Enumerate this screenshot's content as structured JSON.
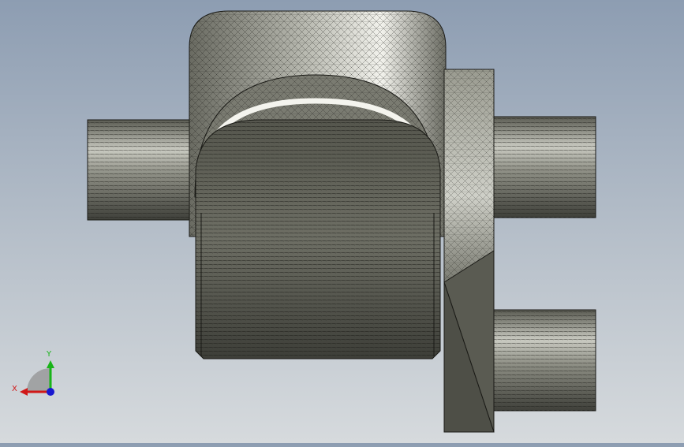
{
  "viewport": {
    "background_top": "#8d9db2",
    "background_bottom": "#d6dadd"
  },
  "model": {
    "icon": "mesh-model-icon",
    "fill_dark": "#55564d",
    "fill_mid": "#8a8b80",
    "fill_light": "#d9dad2",
    "edge_color": "#1a1a16"
  },
  "triad": {
    "x_label": "X",
    "y_label": "Y",
    "x_color": "#d01818",
    "y_color": "#18b418",
    "z_color": "#1818d0"
  }
}
